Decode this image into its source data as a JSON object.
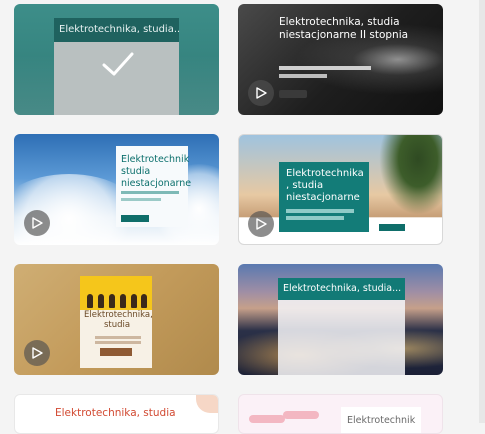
{
  "cards": [
    {
      "title": "Elektrotechnika, studia...",
      "selected": true
    },
    {
      "title": "Elektrotechnika, studia niestacjonarne II stopnia"
    },
    {
      "title": "Elektrotechnik studia niestacjonarne"
    },
    {
      "title": "Elektrotechnika , studia niestacjonarne"
    },
    {
      "title": "Elektrotechnika, studia"
    },
    {
      "title": "Elektrotechnika, studia..."
    },
    {
      "title": "Elektrotechnika, studia"
    },
    {
      "title": "Elektrotechnik"
    }
  ],
  "icons": {
    "play": "play-icon",
    "check": "check-icon"
  },
  "colors": {
    "teal": "#137c78",
    "selected_bg": "#2f7a76"
  }
}
